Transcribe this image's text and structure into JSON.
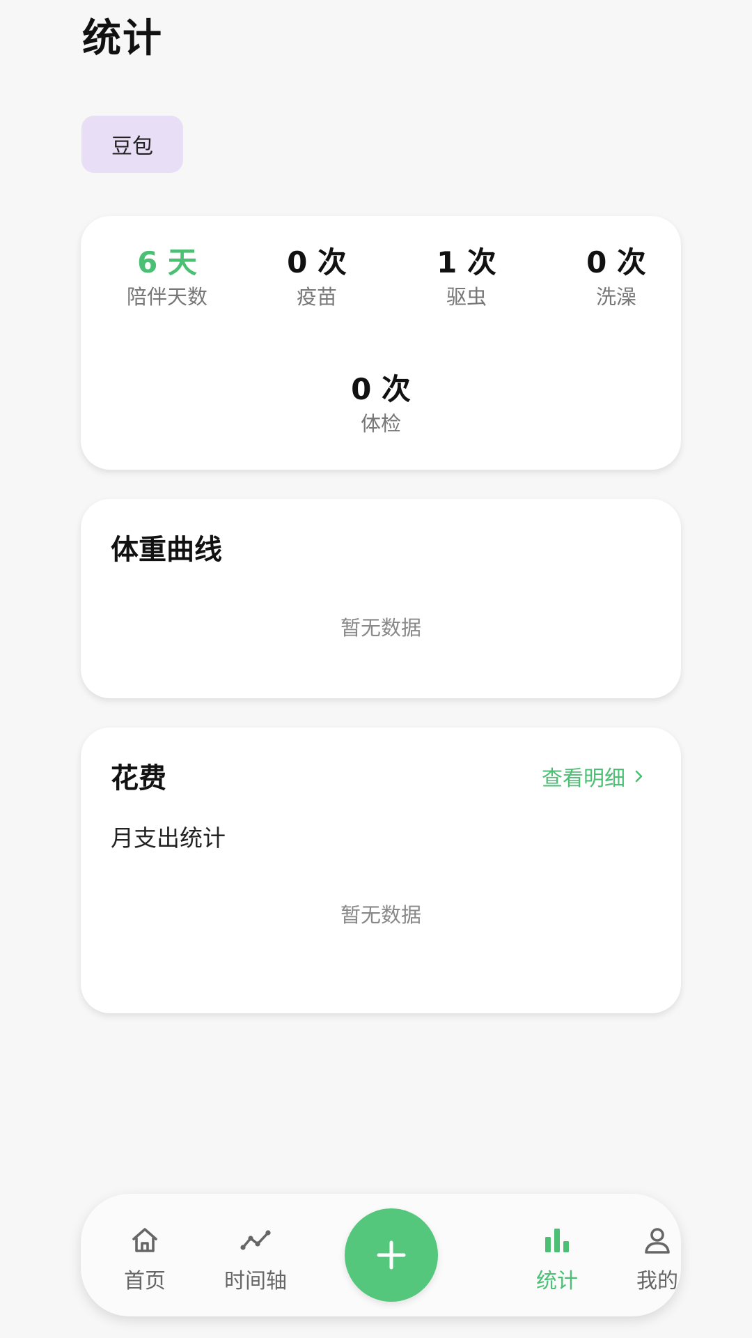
{
  "header": {
    "title": "统计"
  },
  "pet_selector": {
    "selected": "豆包"
  },
  "stats": [
    {
      "value": "6 天",
      "label": "陪伴天数"
    },
    {
      "value": "0 次",
      "label": "疫苗"
    },
    {
      "value": "1 次",
      "label": "驱虫"
    },
    {
      "value": "0 次",
      "label": "洗澡"
    },
    {
      "value": "0 次",
      "label": "体检"
    }
  ],
  "weight_card": {
    "title": "体重曲线",
    "empty_text": "暂无数据"
  },
  "cost_card": {
    "title": "花费",
    "detail_link": "查看明细",
    "subtitle": "月支出统计",
    "empty_text": "暂无数据"
  },
  "bottom_nav": {
    "items": [
      {
        "label": "首页",
        "icon": "home-icon"
      },
      {
        "label": "时间轴",
        "icon": "timeline-icon"
      },
      {
        "label": "统计",
        "icon": "bar-chart-icon",
        "active": true
      },
      {
        "label": "我的",
        "icon": "user-icon"
      }
    ],
    "add_icon": "plus-icon"
  },
  "colors": {
    "accent": "#4bbf73",
    "fab": "#55c77c",
    "chip_bg": "#e8dff6",
    "page_bg": "#f7f7f7"
  }
}
